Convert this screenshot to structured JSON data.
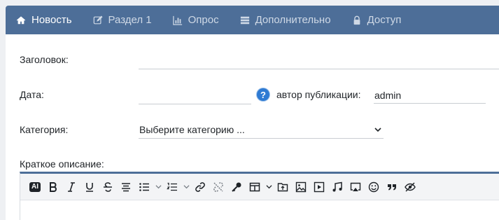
{
  "tabs": [
    {
      "label": "Новость",
      "icon": "home-icon",
      "active": true
    },
    {
      "label": "Раздел 1",
      "icon": "edit-icon",
      "active": false
    },
    {
      "label": "Опрос",
      "icon": "bar-chart-icon",
      "active": false
    },
    {
      "label": "Дополнительно",
      "icon": "list-icon",
      "active": false
    },
    {
      "label": "Доступ",
      "icon": "lock-icon",
      "active": false
    }
  ],
  "form": {
    "title_label": "Заголовок:",
    "title_value": "",
    "date_label": "Дата:",
    "date_value": "",
    "help_glyph": "?",
    "author_label": "автор публикации:",
    "author_value": "admin",
    "category_label": "Категория:",
    "category_selected": "Выберите категорию ...",
    "short_desc_label": "Краткое описание:"
  },
  "toolbar": {
    "ai_label": "AI",
    "buttons": [
      "ai",
      "bold",
      "italic",
      "underline",
      "strikethrough",
      "align-center",
      "bullet-list",
      "numbered-list",
      "link",
      "unlink",
      "key",
      "table",
      "insert-image-folder",
      "image",
      "video",
      "music",
      "cast",
      "emoji",
      "quote",
      "hide"
    ]
  },
  "colors": {
    "tabbar": "#4d6e98",
    "help": "#2f7bd3"
  }
}
